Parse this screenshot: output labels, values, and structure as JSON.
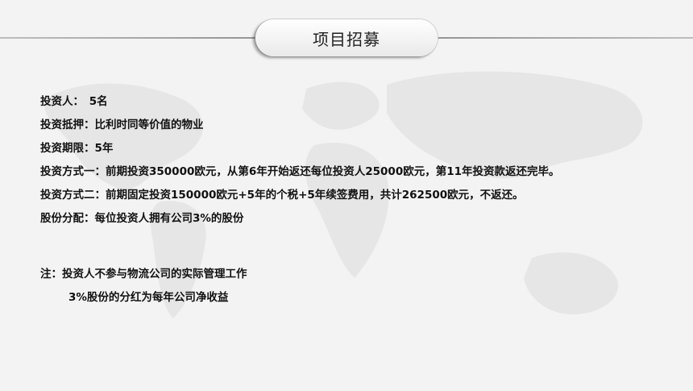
{
  "title": "项目招募",
  "items": [
    "投资人：　5名",
    "投资抵押：比利时同等价值的物业",
    "投资期限：5年",
    "投资方式一：前期投资350000欧元，从第6年开始返还每位投资人25000欧元，第11年投资款返还完毕。",
    "投资方式二：前期固定投资150000欧元+5年的个税+5年续签费用，共计262500欧元，不返还。",
    "股份分配：每位投资人拥有公司3%的股份"
  ],
  "note": {
    "line1": "注：投资人不参与物流公司的实际管理工作",
    "line2": "3%股份的分红为每年公司净收益"
  },
  "colors": {
    "background": "#f3f3f3",
    "text": "#111111",
    "map": "#e4e4e4"
  }
}
